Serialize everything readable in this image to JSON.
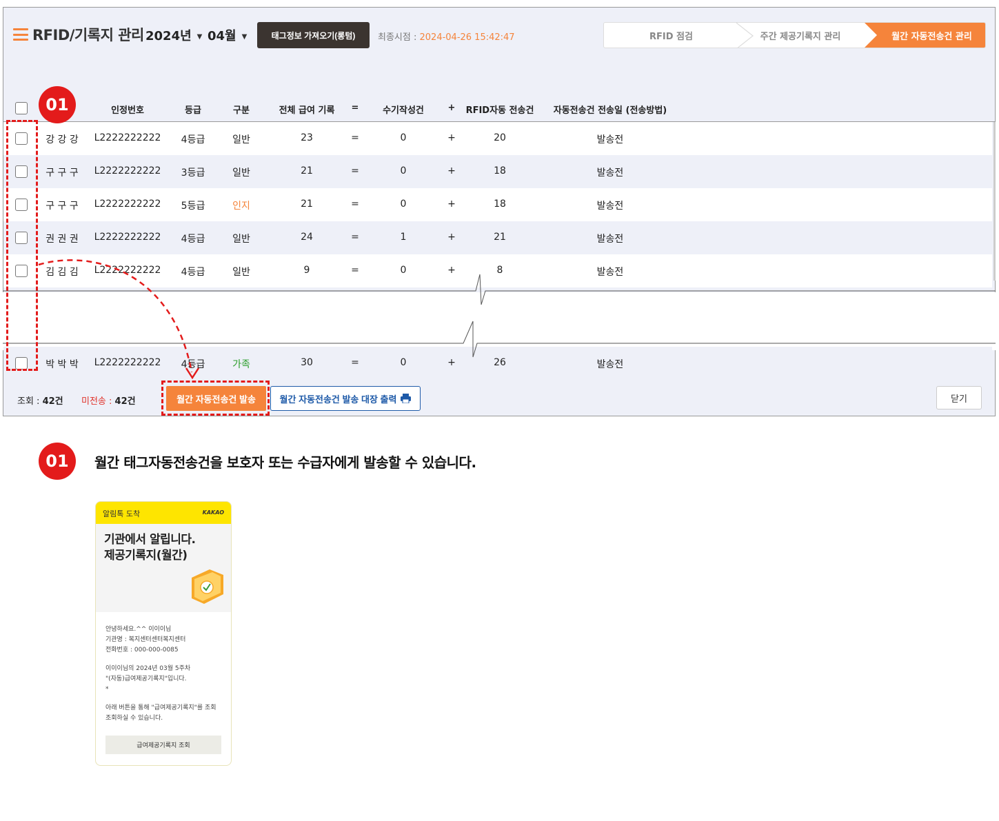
{
  "header": {
    "title": "RFID/기록지 관리",
    "year": "2024년",
    "month": "04월",
    "fetch_button": "태그정보 가져오기(롱텀)",
    "last_time_label": "최종시점 : ",
    "last_time_value": "2024-04-26 15:42:47"
  },
  "steps": [
    "RFID 점검",
    "주간 제공기록지 관리",
    "월간 자동전송건 관리"
  ],
  "table": {
    "columns": [
      "인정번호",
      "등급",
      "구분",
      "전체 급여 기록",
      "=",
      "수기작성건",
      "+",
      "RFID자동 전송건",
      "자동전송건 전송일 (전송방법)"
    ],
    "rows": [
      {
        "name": "강 강 강",
        "id": "L2222222222",
        "grade": "4등급",
        "type": "일반",
        "total": "23",
        "eq": "=",
        "manual": "0",
        "plus": "+",
        "rfid": "20",
        "status": "발송전"
      },
      {
        "name": "구 구 구",
        "id": "L2222222222",
        "grade": "3등급",
        "type": "일반",
        "total": "21",
        "eq": "=",
        "manual": "0",
        "plus": "+",
        "rfid": "18",
        "status": "발송전"
      },
      {
        "name": "구 구 구",
        "id": "L2222222222",
        "grade": "5등급",
        "type": "인지",
        "total": "21",
        "eq": "=",
        "manual": "0",
        "plus": "+",
        "rfid": "18",
        "status": "발송전"
      },
      {
        "name": "권 권 권",
        "id": "L2222222222",
        "grade": "4등급",
        "type": "일반",
        "total": "24",
        "eq": "=",
        "manual": "1",
        "plus": "+",
        "rfid": "21",
        "status": "발송전"
      },
      {
        "name": "김 김 김",
        "id": "L2222222222",
        "grade": "4등급",
        "type": "일반",
        "total": "9",
        "eq": "=",
        "manual": "0",
        "plus": "+",
        "rfid": "8",
        "status": "발송전"
      },
      {
        "name": "박 박 박",
        "id": "L2222222222",
        "grade": "4등급",
        "type": "가족",
        "total": "30",
        "eq": "=",
        "manual": "0",
        "plus": "+",
        "rfid": "26",
        "status": "발송전"
      }
    ]
  },
  "footer": {
    "view_label": "조회 : ",
    "view_count": "42건",
    "unsent_label": "미전송 : ",
    "unsent_count": "42건",
    "send_button": "월간 자동전송건 발송",
    "print_button": "월간 자동전송건 발송 대장 출력",
    "close_button": "닫기"
  },
  "annotation": {
    "badge": "01",
    "description": "월간 태그자동전송건을  보호자 또는 수급자에게 발송할 수 있습니다."
  },
  "kakao": {
    "top_label": "알림톡 도착",
    "brand": "KAKAO",
    "title_line1": "기관에서 알립니다.",
    "title_line2": "제공기록지(월간)",
    "body": [
      "안녕하세요.^^ 이이이님",
      "기관명 : 복지센터센터복지센터",
      "전화번호 : 000-000-0085",
      "",
      "이이이님의 2024년 03월 5주차",
      "\"(자동)급여제공기록지\"입니다.",
      "*",
      "",
      "아래 버튼을 통해 \"급여제공기록지\"를 조회",
      "조회하실 수 있습니다."
    ],
    "button": "급여제공기록지 조회"
  },
  "colors": {
    "accent": "#f5843b",
    "badge": "#e31b1b",
    "dark_button": "#3b3430",
    "link_blue": "#1e5aa8",
    "kakao_yellow": "#fee500"
  }
}
